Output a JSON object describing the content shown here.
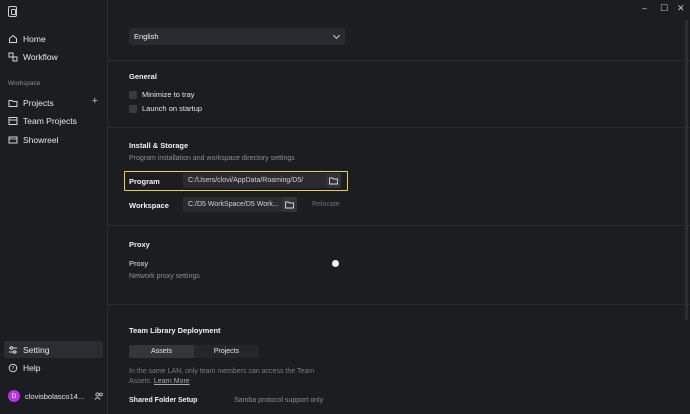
{
  "sidebar": {
    "nav": [
      {
        "label": "Home",
        "icon": "home-icon"
      },
      {
        "label": "Workflow",
        "icon": "workflow-icon"
      }
    ],
    "section_label": "Workspace",
    "workspace_items": [
      {
        "label": "Projects",
        "icon": "folder-icon"
      },
      {
        "label": "Team Projects",
        "icon": "team-projects-icon"
      },
      {
        "label": "Showreel",
        "icon": "showreel-icon"
      }
    ],
    "bottom": [
      {
        "label": "Setting",
        "icon": "sliders-icon"
      },
      {
        "label": "Help",
        "icon": "help-icon"
      }
    ],
    "user": {
      "initial": "D",
      "name": "clovisbolasco14..."
    }
  },
  "window": {
    "minimize": "–",
    "maximize": "☐",
    "close": "✕"
  },
  "language": {
    "selected": "English"
  },
  "general": {
    "title": "General",
    "minimize_to_tray": "Minimize to tray",
    "launch_on_startup": "Launch on startup"
  },
  "storage": {
    "title": "Install & Storage",
    "subtitle": "Program installation and workspace directory settings",
    "program_label": "Program",
    "program_path": "C:/Users/clovi/AppData/Roaming/D5/",
    "workspace_label": "Workspace",
    "workspace_path": "C:/D5 WorkSpace/D5 Work...",
    "relocate": "Relocate"
  },
  "proxy": {
    "title": "Proxy",
    "label": "Proxy",
    "subtitle": "Network proxy settings"
  },
  "team_library": {
    "title": "Team Library Deployment",
    "tab_assets": "Assets",
    "tab_projects": "Projects",
    "description": "In the same LAN, only team members can access the Team Assets.",
    "learn_more": "Learn More",
    "shared_folder": "Shared Folder Setup",
    "samba": "Samba protocol support only"
  },
  "colors": {
    "highlight": "#e8d43a",
    "avatar": "#b734e6",
    "background": "#1c1d21"
  }
}
